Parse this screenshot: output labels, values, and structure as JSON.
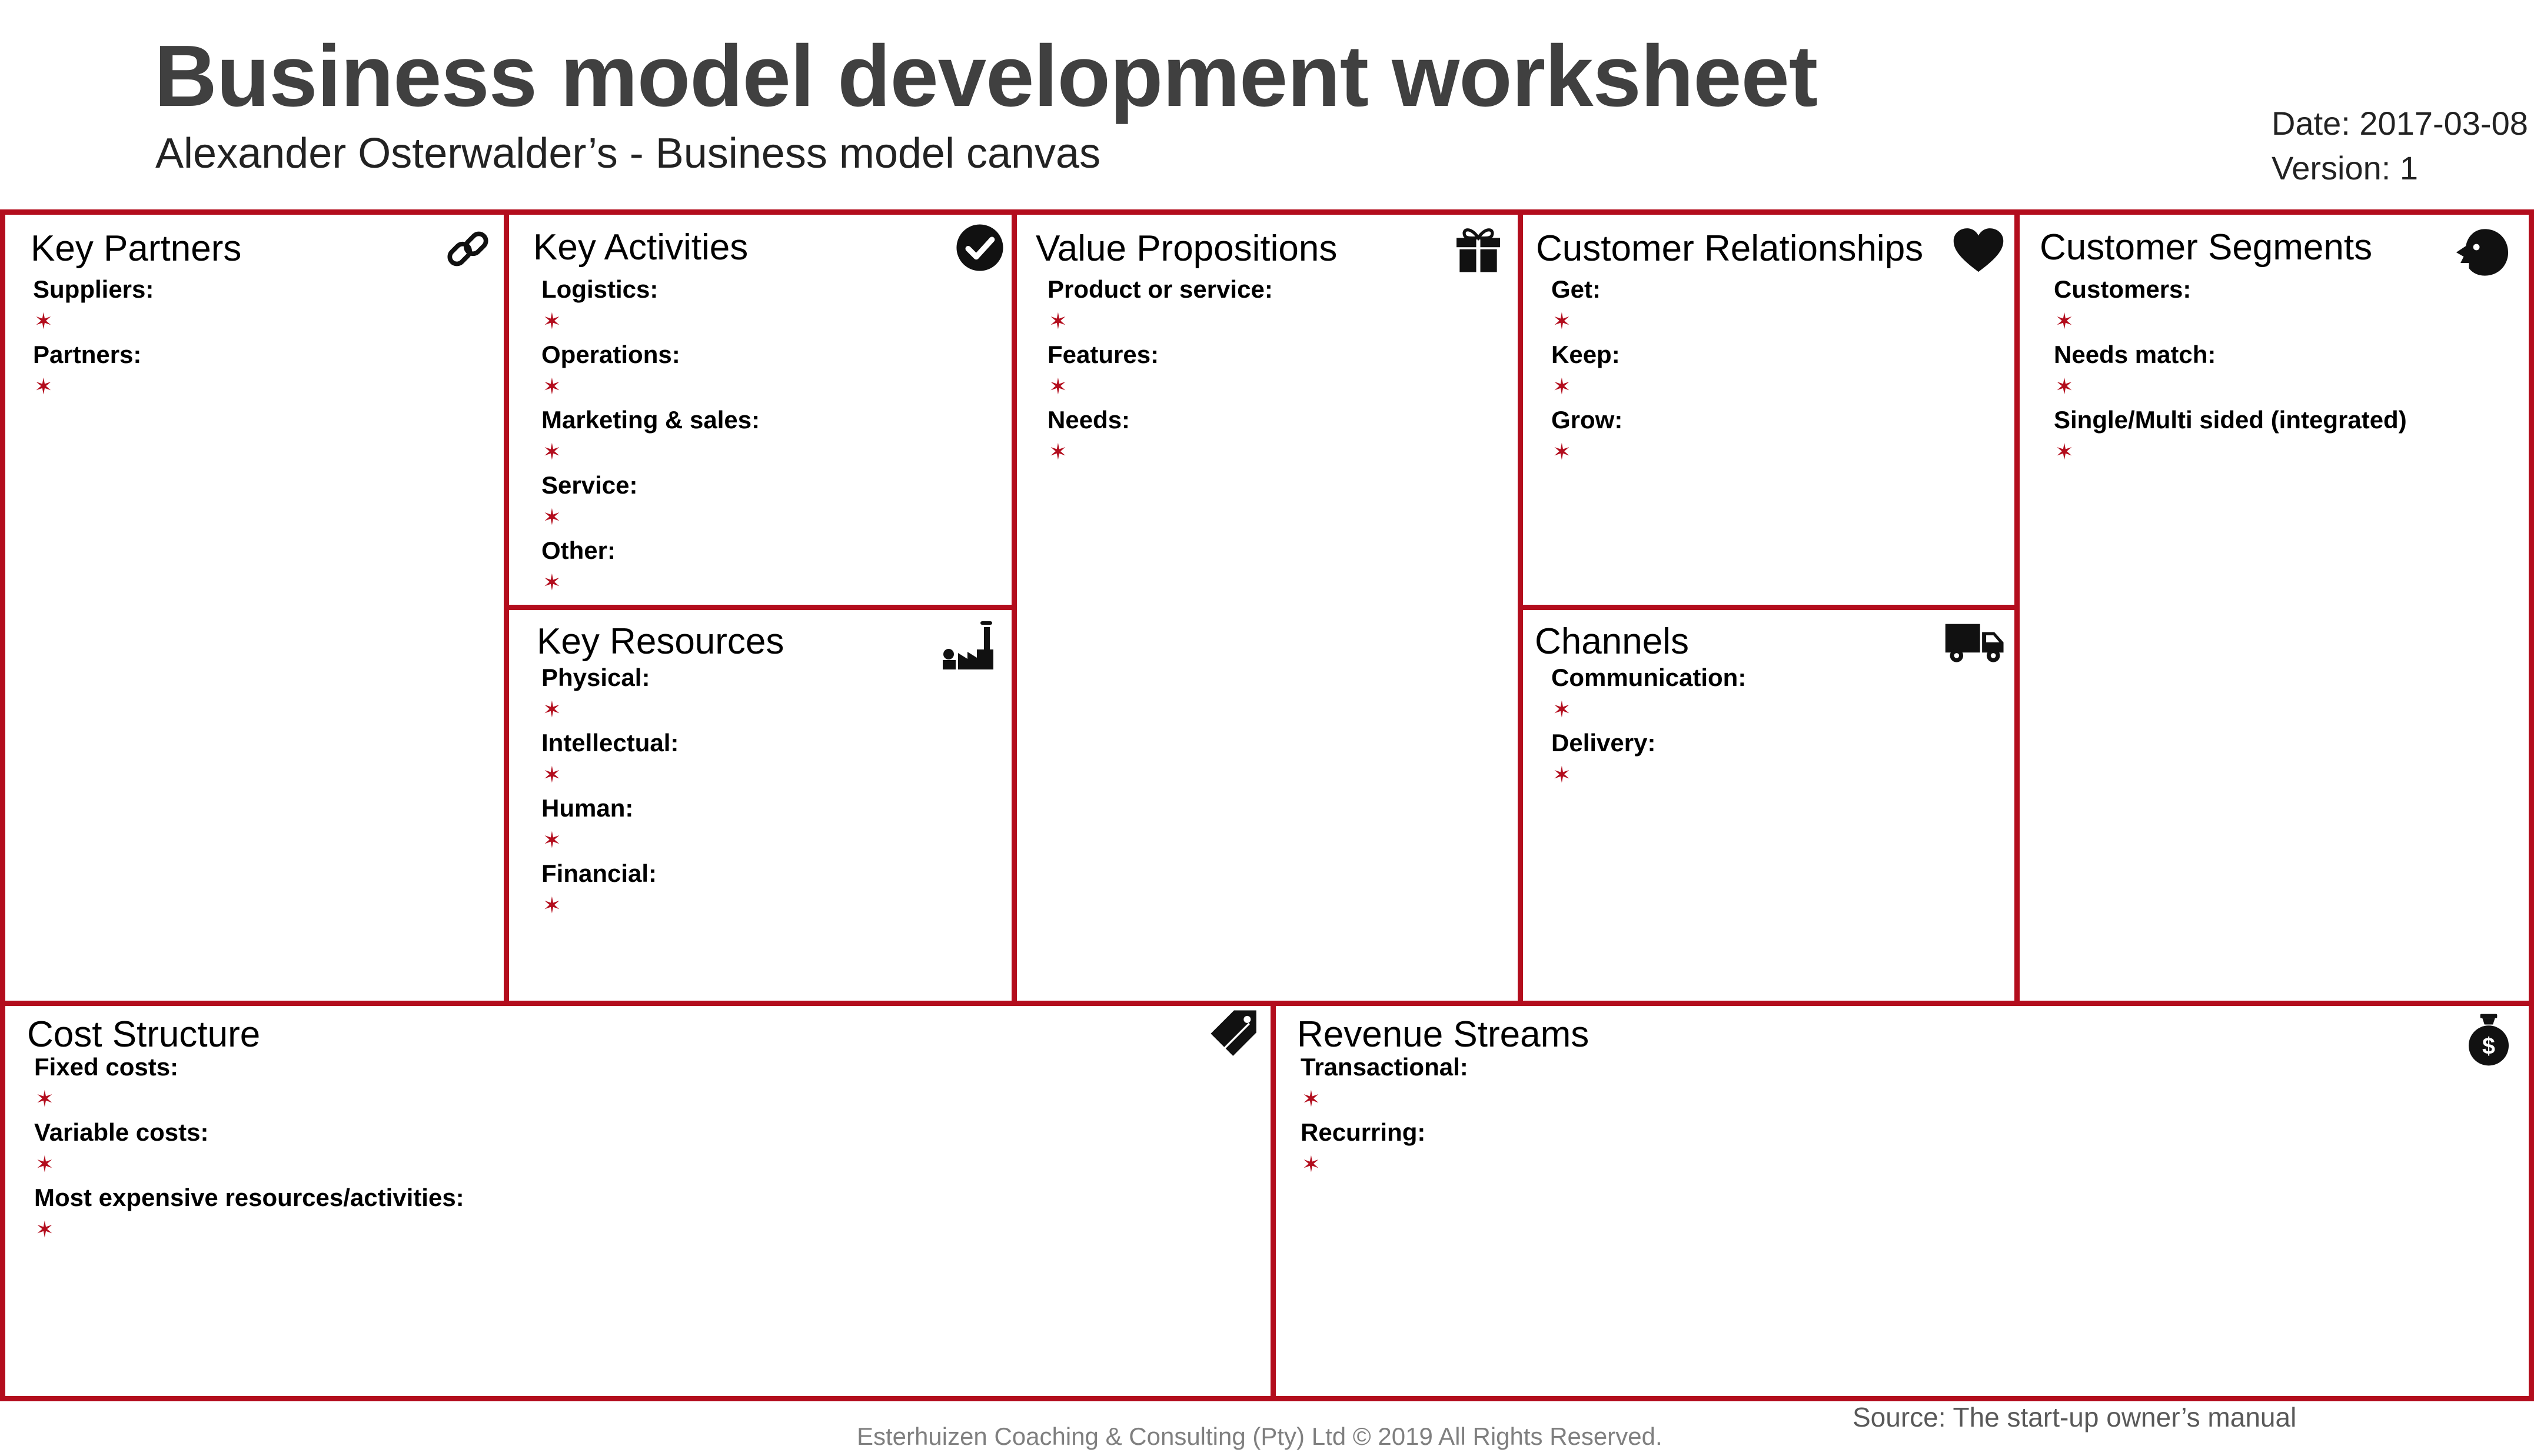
{
  "header": {
    "title": "Business model development worksheet",
    "subtitle": "Alexander Osterwalder’s - Business model canvas",
    "date": "Date: 2017-03-08",
    "version": "Version: 1"
  },
  "colors": {
    "accent": "#b30d1d",
    "title": "#404040",
    "footer": "#7f7f7f"
  },
  "bullet_glyph": "✶",
  "blocks": {
    "key_partners": {
      "title": "Key Partners",
      "icon": "link-icon",
      "items": [
        "Suppliers:",
        "Partners:"
      ]
    },
    "key_activities": {
      "title": "Key Activities",
      "icon": "checkmark-circle-icon",
      "items": [
        "Logistics:",
        "Operations:",
        "Marketing & sales:",
        "Service:",
        "Other:"
      ]
    },
    "key_resources": {
      "title": "Key Resources",
      "icon": "factory-icon",
      "items": [
        "Physical:",
        "Intellectual:",
        "Human:",
        "Financial:"
      ]
    },
    "value_propositions": {
      "title": "Value Propositions",
      "icon": "gift-icon",
      "items": [
        "Product or service:",
        "Features:",
        "Needs:"
      ]
    },
    "customer_relationships": {
      "title": "Customer Relationships",
      "icon": "heart-icon",
      "items": [
        "Get:",
        "Keep:",
        "Grow:"
      ]
    },
    "channels": {
      "title": "Channels",
      "icon": "delivery-truck-icon",
      "items": [
        "Communication:",
        "Delivery:"
      ]
    },
    "customer_segments": {
      "title": "Customer Segments",
      "icon": "customer-head-icon",
      "items": [
        "Customers:",
        "Needs match:",
        "Single/Multi sided (integrated)"
      ]
    },
    "cost_structure": {
      "title": "Cost Structure",
      "icon": "price-tag-icon",
      "items": [
        "Fixed costs:",
        "Variable costs:",
        "Most expensive resources/activities:"
      ]
    },
    "revenue_streams": {
      "title": "Revenue Streams",
      "icon": "money-bag-icon",
      "items": [
        "Transactional:",
        "Recurring:"
      ]
    }
  },
  "footer": {
    "copyright": "Esterhuizen Coaching & Consulting (Pty) Ltd © 2019 All Rights Reserved.",
    "source": "Source: The start-up owner’s manual"
  }
}
